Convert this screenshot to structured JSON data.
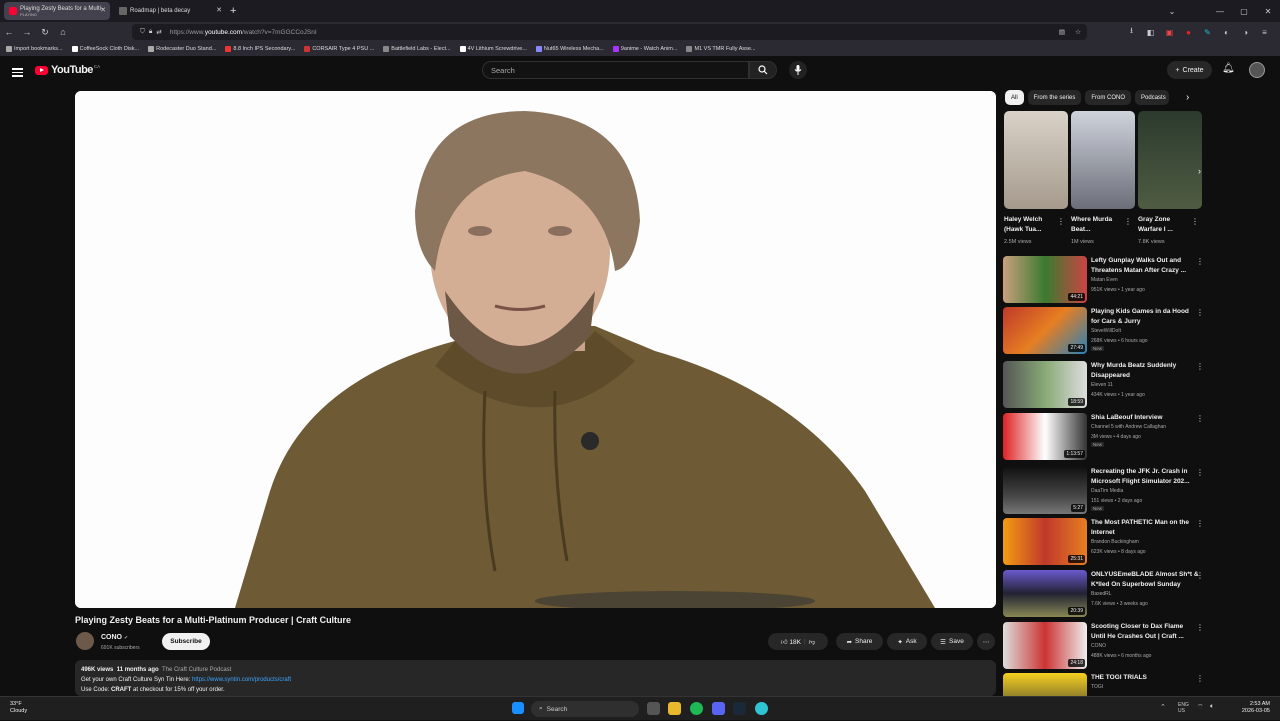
{
  "browser": {
    "tabs": [
      {
        "title": "Playing Zesty Beats for a Multi-",
        "subtitle": "PLAYING"
      },
      {
        "title": "Roadmap | beta decay"
      }
    ],
    "url_prefix": "https://www.",
    "url_domain": "youtube.com",
    "url_path": "/watch?v=7mGGCCoJSnI",
    "bookmarks": [
      "Import bookmarks...",
      "CoffeeSock Cloth Disk...",
      "Rodecaster Duo Stand...",
      "8.8 Inch IPS Secondary...",
      "CORSAIR Type 4 PSU ...",
      "Battlefield Labs - Elect...",
      "4V Lithium Screwdrive...",
      "Nut65 Wireless Mecha...",
      "9anime - Watch Anim...",
      "M1 VS TMR Fully Asse..."
    ]
  },
  "youtube": {
    "logo": "YouTube",
    "country": "CA",
    "search_placeholder": "Search",
    "create_label": "Create"
  },
  "video": {
    "title": "Playing Zesty Beats for a Multi-Platinum Producer | Craft Culture",
    "channel": "CONO",
    "subscribers": "691K subscribers",
    "subscribe_label": "Subscribe",
    "likes": "18K",
    "share_label": "Share",
    "ask_label": "Ask",
    "save_label": "Save",
    "views": "496K views",
    "age": "11 months ago",
    "playlist": "The Craft Culture Podcast",
    "desc_line1": "Get your own Craft Culture Syn Tin Here: ",
    "desc_link": "https://www.syntin.com/products/craft",
    "desc_line2_pre": "Use Code: ",
    "desc_code": "CRAFT",
    "desc_line2_post": " at checkout for 15% off your order."
  },
  "chips": [
    "All",
    "From the series",
    "From CONO",
    "Podcasts"
  ],
  "shorts": [
    {
      "title": "Haley Welch (Hawk Tua...",
      "views": "2.5M views"
    },
    {
      "title": "Where Murda Beat...",
      "views": "1M views"
    },
    {
      "title": "Gray Zone Warfare I ...",
      "views": "7.8K views"
    }
  ],
  "recommendations": [
    {
      "title": "Lefty Gunplay Walks Out and Threatens Matan After Crazy ...",
      "channel": "Matan Even",
      "meta": "951K views • 1 year ago",
      "duration": "44:21",
      "new": ""
    },
    {
      "title": "Playing Kids Games in da Hood for Cars & Jurry",
      "channel": "SteveWillDoIt",
      "meta": "268K views • 6 hours ago",
      "duration": "27:49",
      "new": "New"
    },
    {
      "title": "Why Murda Beatz Suddenly Disappeared",
      "channel": "Eleven 11",
      "meta": "434K views • 1 year ago",
      "duration": "18:59",
      "new": ""
    },
    {
      "title": "Shia LaBeouf Interview",
      "channel": "Channel 5 with Andrew Callaghan",
      "meta": "3M views • 4 days ago",
      "duration": "1:13:57",
      "new": "New"
    },
    {
      "title": "Recreating the JFK Jr. Crash in Microsoft Flight Simulator 202...",
      "channel": "DaaTim Media",
      "meta": "151 views • 2 days ago",
      "duration": "5:27",
      "new": "New"
    },
    {
      "title": "The Most PATHETIC Man on the Internet",
      "channel": "Brandon Buckingham",
      "meta": "623K views • 8 days ago",
      "duration": "25:31",
      "new": ""
    },
    {
      "title": "ONLYUSEmeBLADE Almost Sh*t & K*lled On Superbowl Sunday",
      "channel": "BasedRL",
      "meta": "7.6K views • 3 weeks ago",
      "duration": "20:39",
      "new": ""
    },
    {
      "title": "Scooting Closer to Dax Flame Until He Crashes Out | Craft ...",
      "channel": "CONO",
      "meta": "488K views • 6 months ago",
      "duration": "24:18",
      "new": ""
    },
    {
      "title": "THE TOGI TRIALS",
      "channel": "TOGI",
      "meta": "",
      "duration": "",
      "new": ""
    }
  ],
  "taskbar": {
    "temp": "33°F",
    "condition": "Cloudy",
    "search": "Search",
    "lang1": "ENG",
    "lang2": "US",
    "time": "2:53 AM",
    "date": "2026-03-05"
  },
  "colors": {
    "youtube_red": "#ff0033",
    "link_blue": "#3ea6ff"
  }
}
